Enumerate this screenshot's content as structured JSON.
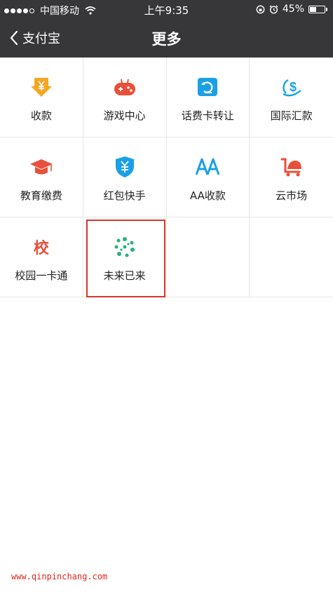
{
  "status_bar": {
    "carrier": "中国移动",
    "time": "上午9:35",
    "battery_percent": "45%",
    "battery_level": 0.45,
    "signal_strength": 4
  },
  "nav": {
    "back_label": "支付宝",
    "title": "更多"
  },
  "grid": {
    "items": [
      {
        "label": "收款",
        "icon": "yen-down-arrow-icon",
        "color": "#f5a623"
      },
      {
        "label": "游戏中心",
        "icon": "gamepad-icon",
        "color": "#e8503a"
      },
      {
        "label": "话费卡转让",
        "icon": "refresh-card-icon",
        "color": "#1aa0e6"
      },
      {
        "label": "国际汇款",
        "icon": "dollar-globe-icon",
        "color": "#1aa0e6"
      },
      {
        "label": "教育缴费",
        "icon": "graduation-cap-icon",
        "color": "#e8503a"
      },
      {
        "label": "红包快手",
        "icon": "yen-shield-icon",
        "color": "#1aa0e6"
      },
      {
        "label": "AA收款",
        "icon": "aa-icon",
        "icon_text": "AA",
        "color": "#1aa0e6"
      },
      {
        "label": "云市场",
        "icon": "cart-icon",
        "color": "#e8503a"
      },
      {
        "label": "校园一卡通",
        "icon": "campus-icon",
        "icon_text": "校",
        "color": "#e8503a"
      },
      {
        "label": "未来已来",
        "icon": "future-dots-icon",
        "color": "#2bb07a",
        "highlighted": true
      }
    ]
  },
  "watermark": "www.qinpinchang.com"
}
